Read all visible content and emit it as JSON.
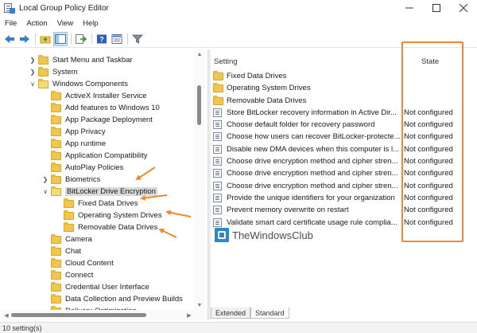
{
  "window": {
    "title": "Local Group Policy Editor"
  },
  "menu": [
    "File",
    "Action",
    "View",
    "Help"
  ],
  "tree": [
    {
      "label": "Start Menu and Taskbar",
      "level": 1,
      "expander": "collapsed"
    },
    {
      "label": "System",
      "level": 1,
      "expander": "collapsed"
    },
    {
      "label": "Windows Components",
      "level": 1,
      "expander": "expanded"
    },
    {
      "label": "ActiveX Installer Service",
      "level": 2,
      "expander": "none"
    },
    {
      "label": "Add features to Windows 10",
      "level": 2,
      "expander": "none"
    },
    {
      "label": "App Package Deployment",
      "level": 2,
      "expander": "none"
    },
    {
      "label": "App Privacy",
      "level": 2,
      "expander": "none"
    },
    {
      "label": "App runtime",
      "level": 2,
      "expander": "none"
    },
    {
      "label": "Application Compatibility",
      "level": 2,
      "expander": "none"
    },
    {
      "label": "AutoPlay Policies",
      "level": 2,
      "expander": "none"
    },
    {
      "label": "Biometrics",
      "level": 2,
      "expander": "collapsed"
    },
    {
      "label": "BitLocker Drive Encryption",
      "level": 2,
      "expander": "expanded",
      "selected": true
    },
    {
      "label": "Fixed Data Drives",
      "level": 3,
      "expander": "none"
    },
    {
      "label": "Operating System Drives",
      "level": 3,
      "expander": "none"
    },
    {
      "label": "Removable Data Drives",
      "level": 3,
      "expander": "none"
    },
    {
      "label": "Camera",
      "level": 2,
      "expander": "none"
    },
    {
      "label": "Chat",
      "level": 2,
      "expander": "none"
    },
    {
      "label": "Cloud Content",
      "level": 2,
      "expander": "none"
    },
    {
      "label": "Connect",
      "level": 2,
      "expander": "none"
    },
    {
      "label": "Credential User Interface",
      "level": 2,
      "expander": "none"
    },
    {
      "label": "Data Collection and Preview Builds",
      "level": 2,
      "expander": "none"
    },
    {
      "label": "Delivery Optimization",
      "level": 2,
      "expander": "none"
    }
  ],
  "columns": {
    "setting": "Setting",
    "state": "State"
  },
  "rows": [
    {
      "type": "folder",
      "name": "Fixed Data Drives",
      "state": ""
    },
    {
      "type": "folder",
      "name": "Operating System Drives",
      "state": ""
    },
    {
      "type": "folder",
      "name": "Removable Data Drives",
      "state": ""
    },
    {
      "type": "setting",
      "name": "Store BitLocker recovery information in Active Dir...",
      "state": "Not configured"
    },
    {
      "type": "setting",
      "name": "Choose default folder for recovery password",
      "state": "Not configured"
    },
    {
      "type": "setting",
      "name": "Choose how users can recover BitLocker-protecte...",
      "state": "Not configured"
    },
    {
      "type": "setting",
      "name": "Disable new DMA devices when this computer is l...",
      "state": "Not configured"
    },
    {
      "type": "setting",
      "name": "Choose drive encryption method and cipher stren...",
      "state": "Not configured"
    },
    {
      "type": "setting",
      "name": "Choose drive encryption method and cipher stren...",
      "state": "Not configured"
    },
    {
      "type": "setting",
      "name": "Choose drive encryption method and cipher stren...",
      "state": "Not configured"
    },
    {
      "type": "setting",
      "name": "Provide the unique identifiers for your organization",
      "state": "Not configured"
    },
    {
      "type": "setting",
      "name": "Prevent memory overwrite on restart",
      "state": "Not configured"
    },
    {
      "type": "setting",
      "name": "Validate smart card certificate usage rule complia...",
      "state": "Not configured"
    }
  ],
  "watermark": "TheWindowsClub",
  "tabs": [
    {
      "label": "Extended",
      "active": false
    },
    {
      "label": "Standard",
      "active": true
    }
  ],
  "status": "10 setting(s)",
  "colors": {
    "annotation": "#ef8a2b",
    "folder": "#f0c64e",
    "selection": "#d9d9d9"
  }
}
